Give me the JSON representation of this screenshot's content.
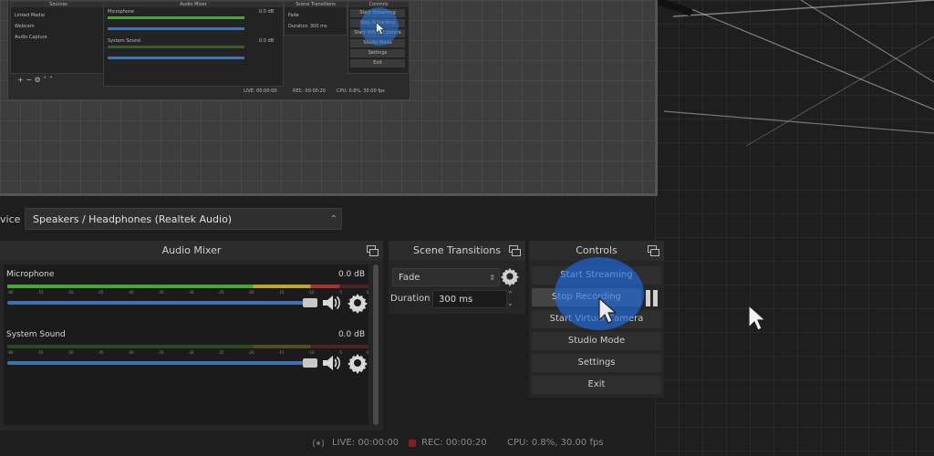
{
  "mini_ui": {
    "panels": [
      "Sources",
      "Audio Mixer",
      "Scene Transitions",
      "Controls"
    ],
    "sources": [
      "Linked Media",
      "Webcam",
      "Audio Capture"
    ],
    "channels": [
      {
        "name": "Microphone",
        "db": "0.0 dB"
      },
      {
        "name": "System Sound",
        "db": "0.0 dB"
      }
    ],
    "transition": "Fade",
    "duration_label": "Duration",
    "duration": "300 ms",
    "controls": [
      "Start Streaming",
      "Stop Recording",
      "Start Virtual Camera",
      "Studio Mode",
      "Settings",
      "Exit"
    ],
    "status": {
      "live": "LIVE: 00:00:00",
      "rec": "REC: 00:00:20",
      "cpu": "CPU: 0.8%, 30.00 fps"
    }
  },
  "device": {
    "label": "vice",
    "value": "Speakers / Headphones (Realtek Audio)"
  },
  "audio_mixer": {
    "title": "Audio Mixer",
    "scale_ticks": [
      "-60",
      "-55",
      "-50",
      "-45",
      "-40",
      "-35",
      "-30",
      "-25",
      "-20",
      "-15",
      "-10",
      "-5",
      "0"
    ],
    "channels": [
      {
        "name": "Microphone",
        "db": "0.0 dB",
        "level": 0.92,
        "volume": 1.0
      },
      {
        "name": "System Sound",
        "db": "0.0 dB",
        "level": 0.0,
        "volume": 1.0
      }
    ]
  },
  "scene_transitions": {
    "title": "Scene Transitions",
    "transition": "Fade",
    "duration_label": "Duration",
    "duration": "300 ms"
  },
  "controls": {
    "title": "Controls",
    "buttons": [
      "Start Streaming",
      "Stop Recording",
      "Start Virtual Camera",
      "Studio Mode",
      "Settings",
      "Exit"
    ]
  },
  "status": {
    "live": "LIVE: 00:00:00",
    "rec": "REC: 00:00:20",
    "cpu": "CPU: 0.8%, 30.00 fps"
  },
  "colors": {
    "meter_green": "#46a637",
    "meter_yellow": "#b9a92b",
    "meter_red": "#a83232",
    "slider_blue": "#3d73b5",
    "highlight": "#1e6ee6"
  },
  "icons": [
    "speaker-icon",
    "gear-icon",
    "pause-icon",
    "float-icon",
    "cursor-icon"
  ]
}
